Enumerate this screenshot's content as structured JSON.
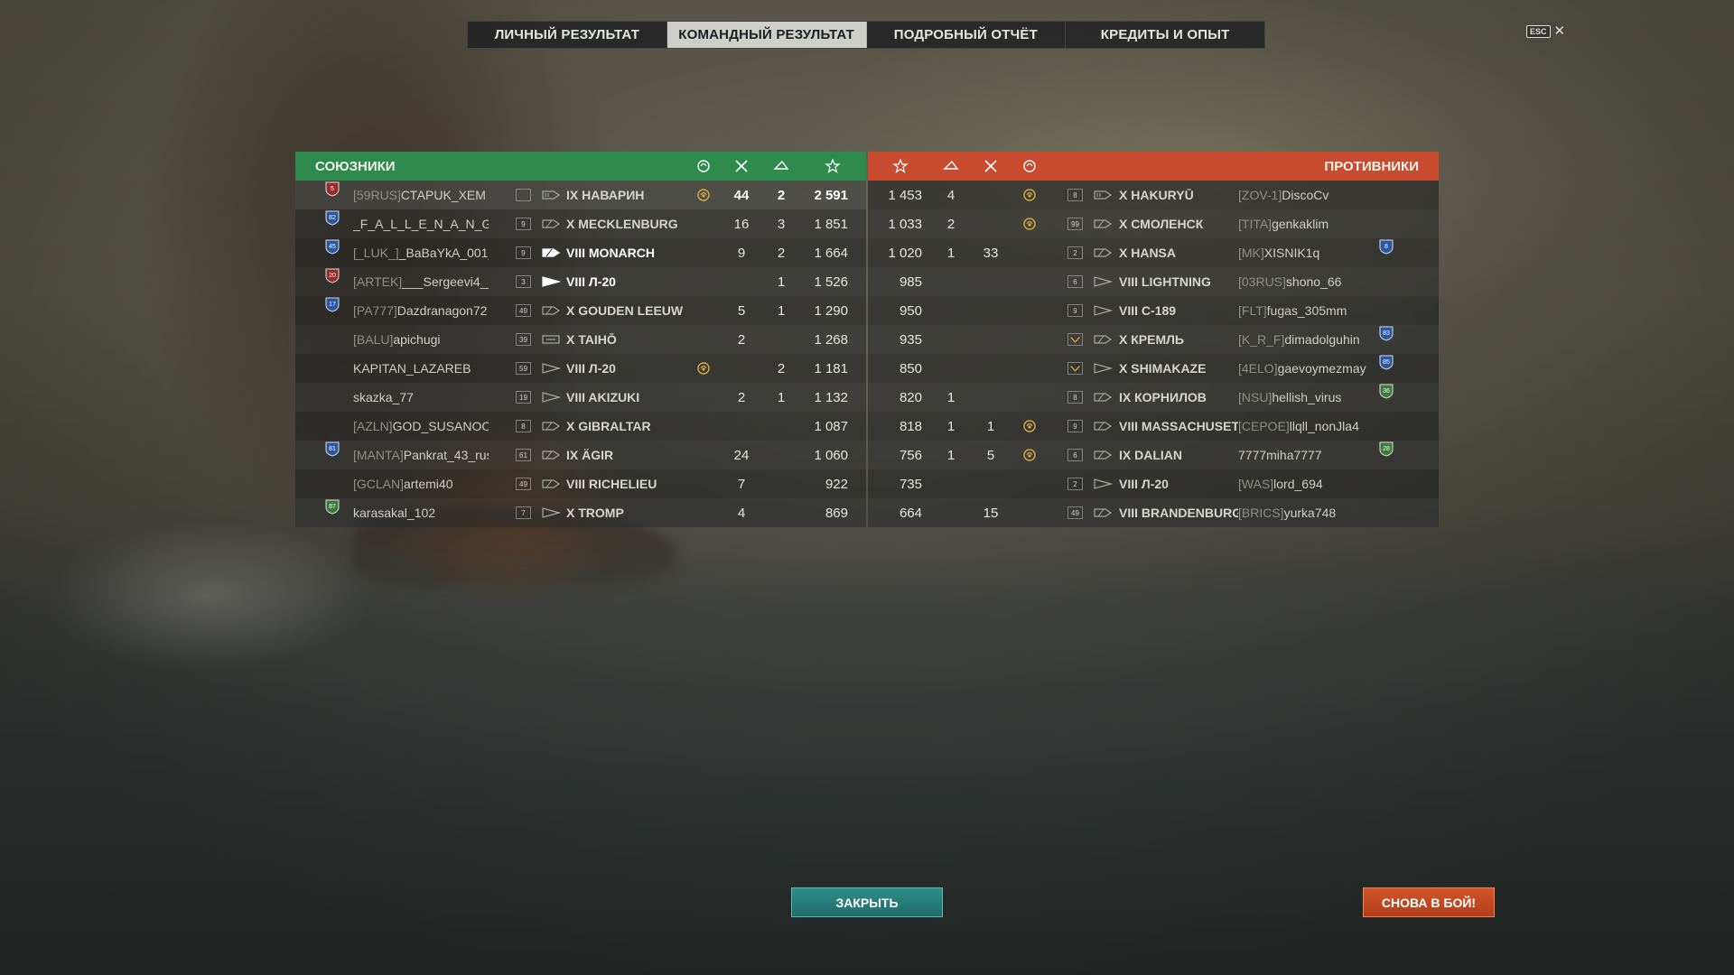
{
  "tabs": [
    {
      "label": "ЛИЧНЫЙ РЕЗУЛЬТАТ",
      "active": false
    },
    {
      "label": "КОМАНДНЫЙ РЕЗУЛЬТАТ",
      "active": true
    },
    {
      "label": "ПОДРОБНЫЙ ОТЧЁТ",
      "active": false
    },
    {
      "label": "КРЕДИТЫ И ОПЫТ",
      "active": false
    }
  ],
  "esc": {
    "key": "ESC",
    "close": "✕"
  },
  "colors": {
    "allies_header": "#2f8a4e",
    "enemies_header": "#c84b30",
    "close_button": "#2c8c88",
    "battle_button": "#d4552a"
  },
  "allies": {
    "title": "СОЮЗНИКИ",
    "columns": [
      "laurel-icon",
      "kills-icon",
      "planes-icon",
      "star-icon"
    ],
    "rows": [
      {
        "badge": "5",
        "badge_color": "red",
        "clan": "[59RUS]",
        "name": "СТАРUK_XEM",
        "level": "",
        "ship_icon": "battleship",
        "ship": "IX НАВАРИН",
        "laurel": true,
        "kills": "44",
        "planes": "2",
        "xp": "2 591",
        "self": true
      },
      {
        "badge": "82",
        "badge_color": "blue",
        "clan": "",
        "name": "_F_A_L_L_E_N_A_N_G...",
        "level": "9",
        "ship_icon": "cruiser",
        "ship": "X MECKLENBURG",
        "laurel": false,
        "kills": "16",
        "planes": "3",
        "xp": "1 851"
      },
      {
        "badge": "45",
        "badge_color": "blue",
        "clan": "[_LUK_]",
        "name": "_BaBaYkA_001_",
        "level": "9",
        "ship_icon": "cruiser-bright",
        "ship": "VIII MONARCH",
        "laurel": false,
        "kills": "9",
        "planes": "2",
        "xp": "1 664",
        "bright": true
      },
      {
        "badge": "20",
        "badge_color": "red",
        "clan": "[ARTEK]",
        "name": "___Sergeevi4__",
        "level": "3",
        "ship_icon": "destroyer-bright",
        "ship": "VIII Л-20",
        "laurel": false,
        "kills": "",
        "planes": "1",
        "xp": "1 526",
        "bright": true
      },
      {
        "badge": "17",
        "badge_color": "blue",
        "clan": "[PA777]",
        "name": "Dazdranagon72",
        "level": "49",
        "ship_icon": "cruiser",
        "ship": "X GOUDEN LEEUW",
        "laurel": false,
        "kills": "5",
        "planes": "1",
        "xp": "1 290"
      },
      {
        "badge": "",
        "badge_color": "",
        "clan": "[BALU]",
        "name": "apichugi",
        "level": "39",
        "ship_icon": "carrier",
        "ship": "X TAIHŌ",
        "laurel": false,
        "kills": "2",
        "planes": "",
        "xp": "1 268"
      },
      {
        "badge": "",
        "badge_color": "",
        "clan": "",
        "name": "KAPITAN_LAZAREB",
        "level": "59",
        "ship_icon": "destroyer",
        "ship": "VIII Л-20",
        "laurel": true,
        "kills": "",
        "planes": "2",
        "xp": "1 181"
      },
      {
        "badge": "",
        "badge_color": "",
        "clan": "",
        "name": "skazka_77",
        "level": "19",
        "ship_icon": "destroyer",
        "ship": "VIII AKIZUKI",
        "laurel": false,
        "kills": "2",
        "planes": "1",
        "xp": "1 132"
      },
      {
        "badge": "",
        "badge_color": "",
        "clan": "[AZLN]",
        "name": "GOD_SUSANOO...",
        "level": "8",
        "ship_icon": "cruiser",
        "ship": "X GIBRALTAR",
        "laurel": false,
        "kills": "",
        "planes": "",
        "xp": "1 087"
      },
      {
        "badge": "81",
        "badge_color": "blue",
        "clan": "[MANTA]",
        "name": "Pankrat_43_rus",
        "level": "61",
        "ship_icon": "cruiser",
        "ship": "IX ÄGIR",
        "laurel": false,
        "kills": "24",
        "planes": "",
        "xp": "1 060"
      },
      {
        "badge": "",
        "badge_color": "",
        "clan": "[GCLAN]",
        "name": "artemi40",
        "level": "49",
        "ship_icon": "cruiser",
        "ship": "VIII RICHELIEU",
        "laurel": false,
        "kills": "7",
        "planes": "",
        "xp": "922"
      },
      {
        "badge": "87",
        "badge_color": "green",
        "clan": "",
        "name": "karasakal_102",
        "level": "7",
        "ship_icon": "destroyer",
        "ship": "X TROMP",
        "laurel": false,
        "kills": "4",
        "planes": "",
        "xp": "869"
      }
    ]
  },
  "enemies": {
    "title": "ПРОТИВНИКИ",
    "columns": [
      "star-icon",
      "planes-icon",
      "kills-icon",
      "laurel-icon"
    ],
    "rows": [
      {
        "xp": "1 453",
        "planes": "4",
        "kills": "",
        "laurel": true,
        "level": "8",
        "ship_icon": "battleship",
        "ship": "X HAKURYŪ",
        "clan": "[ZOV-1]",
        "name": "DiscoCv",
        "badge": "",
        "badge_color": ""
      },
      {
        "xp": "1 033",
        "planes": "2",
        "kills": "",
        "laurel": true,
        "level": "99",
        "ship_icon": "cruiser",
        "ship": "X СМОЛЕНСК",
        "clan": "[TITA]",
        "name": "genkaklim",
        "badge": "",
        "badge_color": ""
      },
      {
        "xp": "1 020",
        "planes": "1",
        "kills": "33",
        "laurel": false,
        "level": "2",
        "ship_icon": "cruiser",
        "ship": "X HANSA",
        "clan": "[MK]",
        "name": "XISNIK1q",
        "badge": "8",
        "badge_color": "blue"
      },
      {
        "xp": "985",
        "planes": "",
        "kills": "",
        "laurel": false,
        "level": "6",
        "ship_icon": "destroyer",
        "ship": "VIII LIGHTNING",
        "clan": "[03RUS]",
        "name": "shono_66",
        "badge": "",
        "badge_color": ""
      },
      {
        "xp": "950",
        "planes": "",
        "kills": "",
        "laurel": false,
        "level": "9",
        "ship_icon": "destroyer",
        "ship": "VIII С-189",
        "clan": "[FLT]",
        "name": "fugas_305mm",
        "badge": "",
        "badge_color": ""
      },
      {
        "xp": "935",
        "planes": "",
        "kills": "",
        "laurel": false,
        "level": "chevron",
        "ship_icon": "cruiser",
        "ship": "X КРЕМЛЬ",
        "clan": "[K_R_F]",
        "name": "dimadolguhin",
        "badge": "83",
        "badge_color": "blue"
      },
      {
        "xp": "850",
        "planes": "",
        "kills": "",
        "laurel": false,
        "level": "chevron",
        "ship_icon": "destroyer",
        "ship": "X SHIMAKAZE",
        "clan": "[4ELO]",
        "name": "gaevoymezmay",
        "badge": "85",
        "badge_color": "blue"
      },
      {
        "xp": "820",
        "planes": "1",
        "kills": "",
        "laurel": false,
        "level": "8",
        "ship_icon": "cruiser",
        "ship": "IX КОРНИЛОВ",
        "clan": "[NSU]",
        "name": "hellish_virus",
        "badge": "36",
        "badge_color": "green"
      },
      {
        "xp": "818",
        "planes": "1",
        "kills": "1",
        "laurel": true,
        "level": "9",
        "ship_icon": "cruiser",
        "ship": "VIII MASSACHUSETT...",
        "clan": "[CEPOE]",
        "name": "llqll_nonJla4",
        "badge": "",
        "badge_color": ""
      },
      {
        "xp": "756",
        "planes": "1",
        "kills": "5",
        "laurel": true,
        "level": "6",
        "ship_icon": "cruiser",
        "ship": "IX DALIAN",
        "clan": "",
        "name": "7777miha7777",
        "badge": "28",
        "badge_color": "green"
      },
      {
        "xp": "735",
        "planes": "",
        "kills": "",
        "laurel": false,
        "level": "2",
        "ship_icon": "destroyer",
        "ship": "VIII Л-20",
        "clan": "[WAS]",
        "name": "lord_694",
        "badge": "",
        "badge_color": ""
      },
      {
        "xp": "664",
        "planes": "",
        "kills": "15",
        "laurel": false,
        "level": "49",
        "ship_icon": "cruiser",
        "ship": "VIII BRANDENBURG B",
        "clan": "[BRICS]",
        "name": "yurka748",
        "badge": "",
        "badge_color": ""
      }
    ]
  },
  "buttons": {
    "close": "ЗАКРЫТЬ",
    "battle": "СНОВА В БОЙ!"
  }
}
